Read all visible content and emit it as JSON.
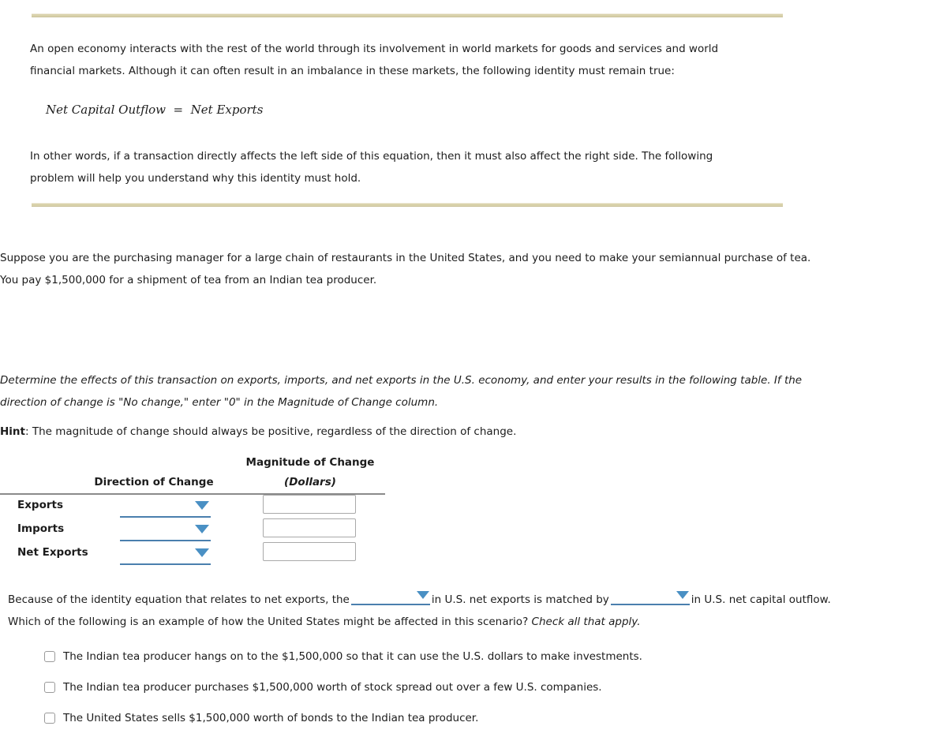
{
  "theme": {
    "divider_color": "#d9d2ab",
    "dropdown_accent": "#4a90c4",
    "dropdown_line": "#4a7fae",
    "rule_color": "#8a8a8a",
    "text_color": "#1c1c1c",
    "input_border": "#a9a9a9"
  },
  "intro": {
    "paragraph1": "An open economy interacts with the rest of the world through its involvement in world markets for goods and services and world financial markets. Although it can often result in an imbalance in these markets, the following identity must remain true:",
    "equation": "Net Capital Outflow  =  Net Exports",
    "paragraph2": "In other words, if a transaction directly affects the left side of this equation, then it must also affect the right side. The following problem will help you understand why this identity must hold."
  },
  "scenario": {
    "text": "Suppose you are the purchasing manager for a large chain of restaurants in the United States, and you need to make your semiannual purchase of tea. You pay $1,500,000 for a shipment of tea from an Indian tea producer."
  },
  "instructions": {
    "italic_text": "Determine the effects of this transaction on exports, imports, and net exports in the U.S. economy, and enter your results in the following table. If the direction of change is \"No change,\" enter \"0\" in the Magnitude of Change column.",
    "hint_label": "Hint",
    "hint_text": ": The magnitude of change should always be positive, regardless of the direction of change."
  },
  "table": {
    "headers": {
      "direction": "Direction of Change",
      "magnitude_line1": "Magnitude of Change",
      "magnitude_line2": "(Dollars)"
    },
    "rows": [
      {
        "label": "Exports",
        "direction_value": "",
        "magnitude_value": "",
        "magnitude_placeholder": ""
      },
      {
        "label": "Imports",
        "direction_value": "",
        "magnitude_value": "",
        "magnitude_placeholder": ""
      },
      {
        "label": "Net Exports",
        "direction_value": "",
        "magnitude_value": "",
        "magnitude_placeholder": ""
      }
    ]
  },
  "closing": {
    "part1": "Because of the identity equation that relates to net exports, the",
    "dropdown1_value": "",
    "part2": "in U.S. net exports is matched by",
    "dropdown2_value": "",
    "part3": "in U.S. net capital outflow. Which of the following is an example of how the United States might be affected in this scenario?",
    "part4_italic": "Check all that apply."
  },
  "options": [
    {
      "label": "The Indian tea producer hangs on to the $1,500,000 so that it can use the U.S. dollars to make investments.",
      "checked": false
    },
    {
      "label": "The Indian tea producer purchases $1,500,000 worth of stock spread out over a few U.S. companies.",
      "checked": false
    },
    {
      "label": "The United States sells $1,500,000 worth of bonds to the Indian tea producer.",
      "checked": false
    }
  ]
}
